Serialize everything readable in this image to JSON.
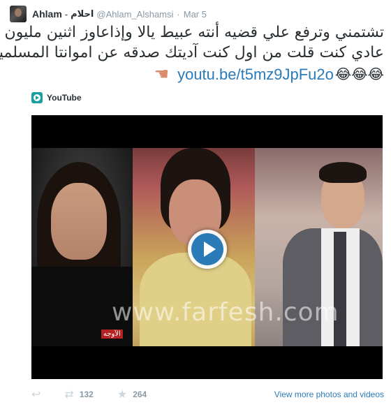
{
  "tweet": {
    "author_name": "Ahlam",
    "author_name_arabic": "احلام",
    "handle": "@Ahlam_Alshamsi",
    "date": "Mar 5",
    "text_lines": [
      "تشتمني وترفع علي قضيه أنته عبيط يالا وإذاعاوز اثنين مليون",
      "عادي كنت قلت من اول كنت آديتك صدقه عن اموانتا المسلمين"
    ],
    "link": "youtu.be/t5mz9JpFu2o",
    "emojis": "😂😂😂",
    "point_icon": "pointing-hand-icon"
  },
  "card": {
    "source": "YouTube",
    "channel_logo": "الآوجه",
    "watermark": "www.farfesh.com"
  },
  "actions": {
    "retweet_count": "132",
    "favorite_count": "264",
    "view_more": "View more photos and videos"
  },
  "colors": {
    "link": "#2b7bb9",
    "muted": "#8899a6",
    "icon": "#ccd6dd",
    "play": "#2b7bb9"
  }
}
